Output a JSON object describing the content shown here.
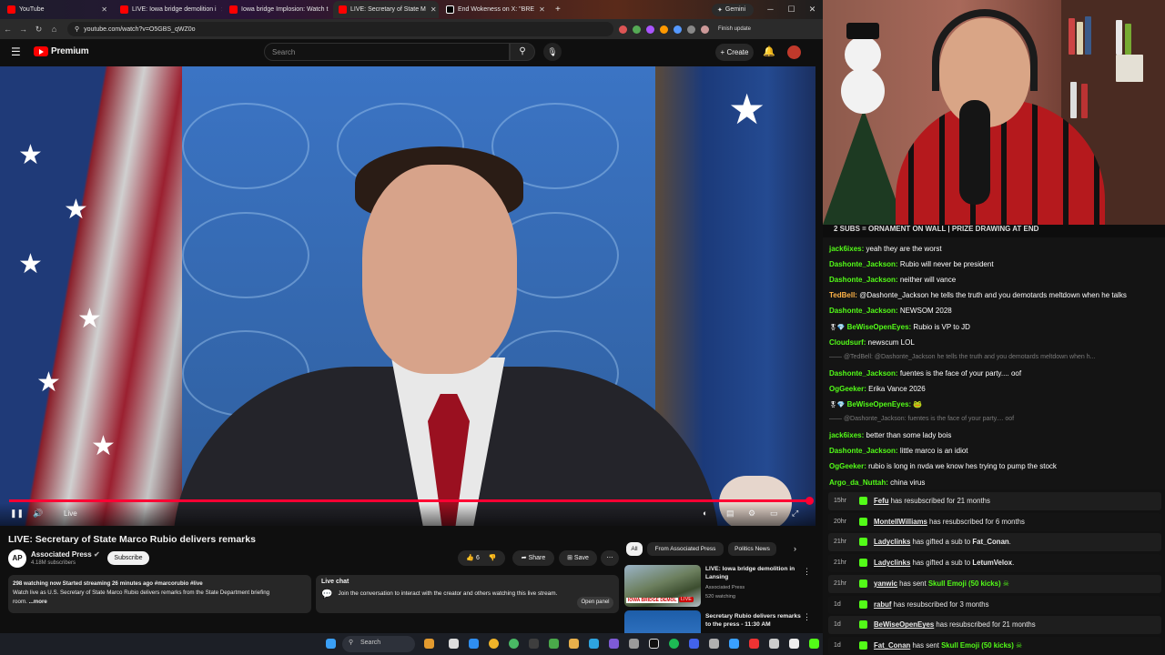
{
  "browser": {
    "tabs": [
      {
        "title": "YouTube",
        "color": "#ff0000"
      },
      {
        "title": "LIVE: Iowa bridge demolition i",
        "color": "#ff0000"
      },
      {
        "title": "Iowa bridge Implosion: Watch t",
        "color": "#ff0000"
      },
      {
        "title": "LIVE: Secretary of State M",
        "color": "#ff0000"
      },
      {
        "title": "End Wokeness on X: \"BRE",
        "color": "#ffffff"
      }
    ],
    "gemini_label": "Gemini",
    "url": "youtube.com/watch?v=O5GBS_qWZ0o",
    "finish_update": "Finish update"
  },
  "youtube": {
    "logo_text": "Premium",
    "search_placeholder": "Search",
    "create_label": "Create"
  },
  "video": {
    "live_label": "Live",
    "progress": 1.0,
    "title": "LIVE: Secretary of State Marco Rubio delivers remarks",
    "channel": "Associated Press",
    "channel_avatar": "AP",
    "subscribers": "4.18M subscribers",
    "subscribe_label": "Subscribe",
    "likes": "6",
    "share_label": "Share",
    "save_label": "Save",
    "description_line1": "298 watching now  Started streaming 26 minutes ago  #marcorubio #live",
    "description_line2": "Watch live as U.S. Secretary of State Marco Rubio delivers remarks from the State Department briefing",
    "description_line3": "room.",
    "more_label": "...more",
    "livechat_title": "Live chat",
    "livechat_text": "Join the conversation to interact with the creator and others watching this live stream.",
    "open_panel": "Open panel"
  },
  "recommendations": {
    "chips": [
      "All",
      "From Associated Press",
      "Politics News"
    ],
    "items": [
      {
        "title": "LIVE: Iowa bridge demolition in Lansing",
        "channel": "Associated Press",
        "meta": "520 watching",
        "badge": "LIVE",
        "thumb_text": "IOWA BRIDGE DEMOL"
      },
      {
        "title": "Secretary Rubio delivers remarks to the press - 11:30 AM",
        "channel": "",
        "meta": "",
        "badge": "",
        "thumb_text": ""
      }
    ]
  },
  "taskbar": {
    "search_label": "Search"
  },
  "stream": {
    "banner": "2 SUBS = ORNAMENT ON WALL | PRIZE DRAWING AT END",
    "chat": [
      {
        "user": "jack6ixes:",
        "text": " yeah they are the worst",
        "color": "#53fc18",
        "dim": false
      },
      {
        "user": "Dashonte_Jackson:",
        "text": " Rubio will never be president",
        "color": "#53fc18",
        "dim": false
      },
      {
        "user": "Dashonte_Jackson:",
        "text": " neither will vance",
        "color": "#53fc18",
        "dim": false
      },
      {
        "user": "TedBell:",
        "text": " @Dashonte_Jackson he tells the truth and you demotards meltdown when he talks",
        "color": "#ffb347",
        "dim": false
      },
      {
        "user": "Dashonte_Jackson:",
        "text": " NEWSOM 2028",
        "color": "#53fc18",
        "dim": false
      },
      {
        "user": "BeWiseOpenEyes:",
        "text": " Rubio is VP to JD",
        "color": "#53fc18",
        "dim": false,
        "badge": true
      },
      {
        "user": "Cloudsurf:",
        "text": " newscum LOL",
        "color": "#53fc18",
        "dim": false
      },
      {
        "user": "",
        "text": "@TedBell: @Dashonte_Jackson he tells the truth and you demotards meltdown when h...",
        "color": "#7a7a7a",
        "dim": true
      },
      {
        "user": "Dashonte_Jackson:",
        "text": " fuentes is the face of your party.... oof",
        "color": "#53fc18",
        "dim": false
      },
      {
        "user": "OgGeeker:",
        "text": " Erika Vance 2026",
        "color": "#53fc18",
        "dim": false
      },
      {
        "user": "BeWiseOpenEyes:",
        "text": " 🐸",
        "color": "#53fc18",
        "dim": false,
        "badge": true
      },
      {
        "user": "",
        "text": "@Dashonte_Jackson: fuentes is the face of your party.... oof",
        "color": "#7a7a7a",
        "dim": true
      },
      {
        "user": "jack6ixes:",
        "text": " better than some lady bois",
        "color": "#53fc18",
        "dim": false
      },
      {
        "user": "Dashonte_Jackson:",
        "text": " little marco is an idiot",
        "color": "#53fc18",
        "dim": false
      },
      {
        "user": "OgGeeker:",
        "text": " rubio is long in nvda we know hes trying to pump the stock",
        "color": "#53fc18",
        "dim": false
      },
      {
        "user": "Argo_da_Nuttah:",
        "text": " china virus",
        "color": "#53fc18",
        "dim": false
      }
    ],
    "events": [
      {
        "time": "15hr",
        "user": "Fefu",
        "text": " has resubscribed for 21 months",
        "extra": "",
        "extra2": ""
      },
      {
        "time": "20hr",
        "user": "MontellWilliams",
        "text": " has resubscribed for 6 months",
        "extra": "",
        "extra2": ""
      },
      {
        "time": "21hr",
        "user": "Ladyclinks",
        "text": " has gifted a sub to ",
        "extra": "Fat_Conan",
        "extra2": "."
      },
      {
        "time": "21hr",
        "user": "Ladyclinks",
        "text": " has gifted a sub to ",
        "extra": "LetumVelox",
        "extra2": "."
      },
      {
        "time": "21hr",
        "user": "yanwic",
        "text": " has sent ",
        "extra": "",
        "extra2": "",
        "green": "Skull Emoji (50 kicks)"
      },
      {
        "time": "1d",
        "user": "rabuf",
        "text": " has resubscribed for 3 months",
        "extra": "",
        "extra2": ""
      },
      {
        "time": "1d",
        "user": "BeWiseOpenEyes",
        "text": " has resubscribed for 21 months",
        "extra": "",
        "extra2": ""
      },
      {
        "time": "1d",
        "user": "Fat_Conan",
        "text": " has sent ",
        "extra": "",
        "extra2": "",
        "green": "Skull Emoji (50 kicks)"
      }
    ]
  }
}
